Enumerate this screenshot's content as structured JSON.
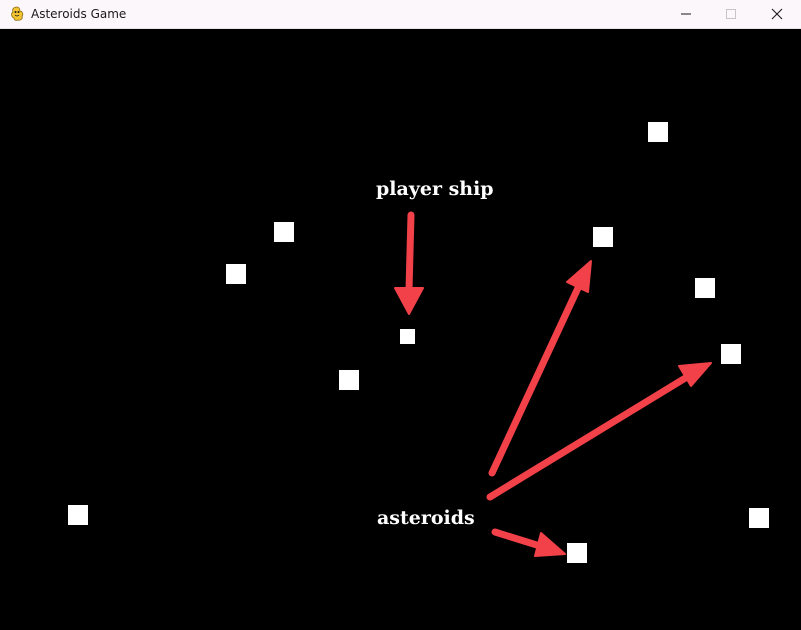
{
  "window": {
    "title": "Asteroids Game",
    "app_icon": "pygame-snake-icon",
    "controls": [
      "minimize-icon",
      "maximize-icon",
      "close-icon"
    ]
  },
  "annotations": {
    "player_label": "player ship",
    "asteroids_label": "asteroids",
    "arrow_color": "#f24149"
  },
  "colors": {
    "background": "#000000",
    "sprite": "#ffffff",
    "titlebar": "#fbf7fb"
  }
}
